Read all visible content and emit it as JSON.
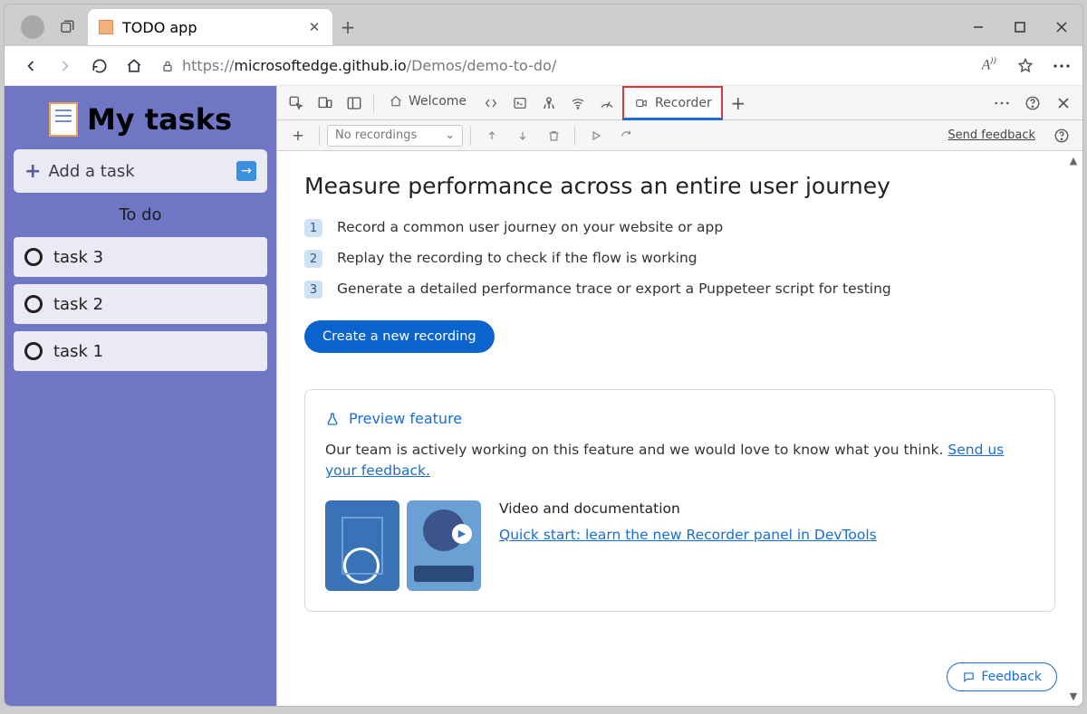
{
  "browser": {
    "tab_title": "TODO app",
    "url_host": "microsoftedge.github.io",
    "url_scheme": "https://",
    "url_path": "/Demos/demo-to-do/"
  },
  "app": {
    "title": "My tasks",
    "add_task_label": "Add a task",
    "section_label": "To do",
    "tasks": [
      "task 3",
      "task 2",
      "task 1"
    ]
  },
  "devtools": {
    "tabs": {
      "welcome": "Welcome",
      "recorder": "Recorder"
    },
    "dropdown_placeholder": "No recordings",
    "send_feedback_link": "Send feedback",
    "heading": "Measure performance across an entire user journey",
    "steps": [
      "Record a common user journey on your website or app",
      "Replay the recording to check if the flow is working",
      "Generate a detailed performance trace or export a Puppeteer script for testing"
    ],
    "create_button": "Create a new recording",
    "preview": {
      "title": "Preview feature",
      "body_pre": "Our team is actively working on this feature and we would love to know what you think. ",
      "body_link": "Send us your feedback.",
      "video_heading": "Video and documentation",
      "video_link": "Quick start: learn the new Recorder panel in DevTools"
    },
    "feedback_button": "Feedback"
  }
}
